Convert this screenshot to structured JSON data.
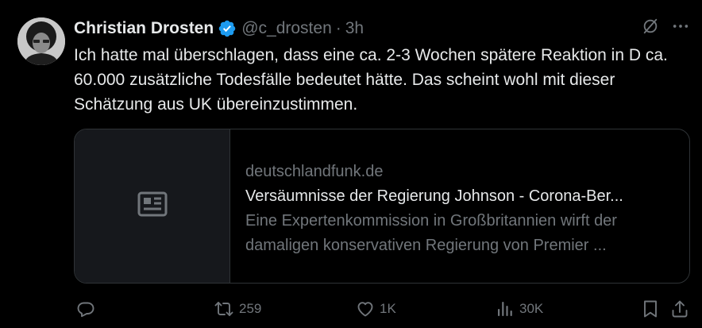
{
  "author": {
    "name": "Christian Drosten",
    "handle": "@c_drosten",
    "separator": "·",
    "time": "3h",
    "verified_icon": "verified-badge-icon"
  },
  "tweet": {
    "text": "Ich hatte mal überschlagen, dass eine ca. 2-3 Wochen spätere Reaktion in D ca. 60.000 zusätzliche Todesfälle bedeutet hätte. Das scheint wohl mit dieser Schätzung aus UK übereinzustimmen."
  },
  "card": {
    "thumbnail_icon": "article-icon",
    "domain": "deutschlandfunk.de",
    "title": "Versäumnisse der Regierung Johnson - Corona-Ber...",
    "description": "Eine Expertenkommission in Großbritannien wirft der damaligen konservativen Regierung von Premier ..."
  },
  "actions": {
    "reply_count": "",
    "retweet_count": "259",
    "like_count": "1K",
    "views_count": "30K"
  },
  "colors": {
    "background": "#000000",
    "text_primary": "#e7e9ea",
    "text_secondary": "#71767b",
    "border": "#2f3336",
    "verified_blue": "#1d9bf0"
  }
}
